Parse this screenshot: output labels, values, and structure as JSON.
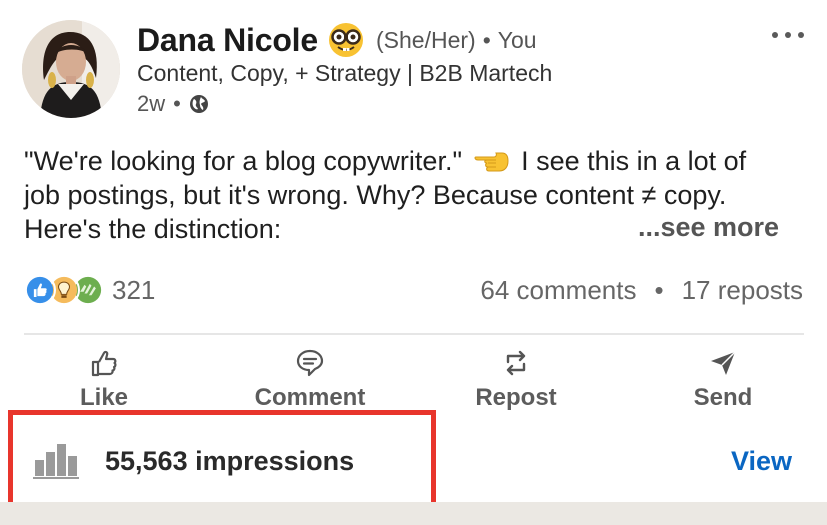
{
  "author": {
    "name": "Dana Nicole",
    "emoji": "nerd-face-emoji",
    "pronouns": "(She/Her)",
    "separator": "•",
    "connection": "You",
    "headline": "Content, Copy, + Strategy | B2B Martech",
    "time": "2w",
    "visibility_icon": "globe-icon"
  },
  "post": {
    "line1_a": "\"We're looking for a blog copywriter.\"",
    "line1_emoji": "backhand-pointing-left-emoji",
    "line1_b": "I see this in a lot of",
    "line2": "job postings, but it's wrong. Why? Because content ≠ copy.",
    "line3": "Here's the distinction:",
    "see_more": "...see more"
  },
  "engagement": {
    "reaction_icons": [
      "like-reaction-icon",
      "insightful-reaction-icon",
      "support-reaction-icon"
    ],
    "reactions_count": "321",
    "comments": "64 comments",
    "separator": "•",
    "reposts": "17 reposts"
  },
  "actions": [
    {
      "label": "Like",
      "icon": "thumbs-up-icon"
    },
    {
      "label": "Comment",
      "icon": "comment-icon"
    },
    {
      "label": "Repost",
      "icon": "repost-icon"
    },
    {
      "label": "Send",
      "icon": "send-icon"
    }
  ],
  "analytics": {
    "icon": "bar-chart-icon",
    "impressions": "55,563 impressions",
    "view_label": "View"
  },
  "colors": {
    "link_blue": "#0a66c2",
    "highlight_red": "#e8352c",
    "like_blue": "#378fe9",
    "insightful_yellow": "#f5bb5c",
    "support_green": "#6dae4f"
  }
}
